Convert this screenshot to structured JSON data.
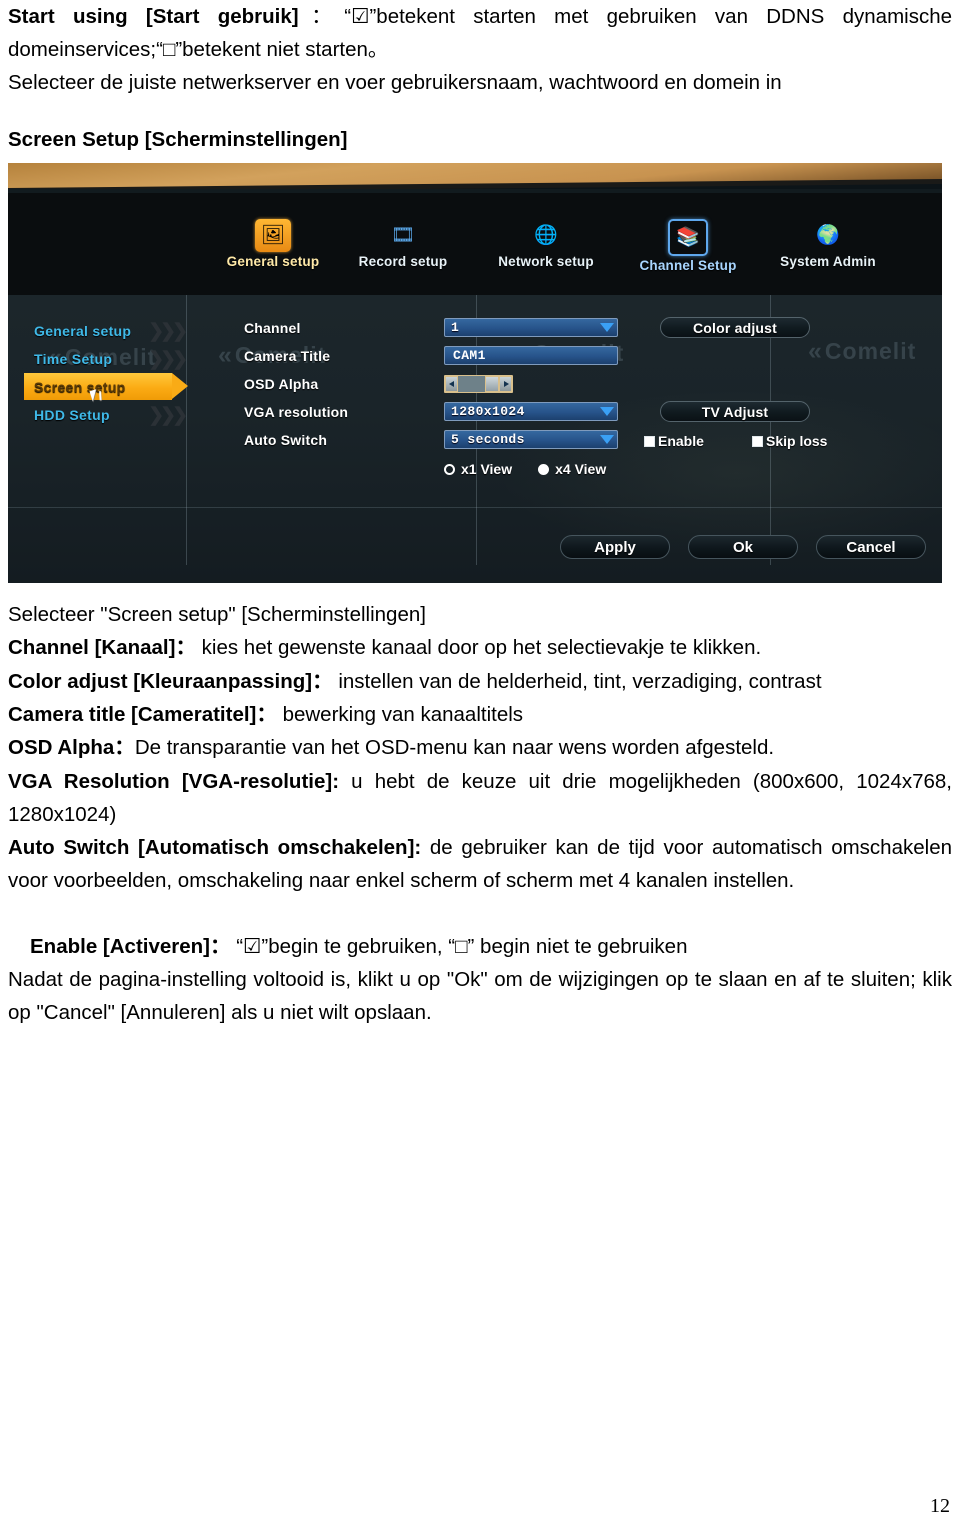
{
  "document": {
    "intro_paragraph_1": "Start using [Start gebruik]：“☑”betekent starten met gebruiken van DDNS dynamische domeinservices;“□”betekent niet starten。",
    "intro_p1_bold": "Start using [Start gebruik]",
    "intro_p1_rest": "：“☑”betekent starten met gebruiken van DDNS dynamische domeinservices;“□”betekent niet starten。",
    "intro_paragraph_2": "Selecteer de juiste netwerkserver en voer gebruikersnaam, wachtwoord en domein in",
    "section_heading": "Screen Setup [Scherminstellingen]",
    "line_select": "Selecteer \"Screen setup\" [Scherminstellingen]",
    "items": [
      {
        "term": "Channel [Kanaal]：",
        "desc": "kies het gewenste kanaal door op het selectievakje te klikken."
      },
      {
        "term": "Color adjust [Kleuraanpassing]：",
        "desc": "instellen van de helderheid, tint, verzadiging, contrast"
      },
      {
        "term": "Camera title [Cameratitel]：",
        "desc": "bewerking van kanaaltitels"
      },
      {
        "term": "OSD Alpha：",
        "desc": "De transparantie van het OSD-menu kan naar wens worden afgesteld."
      },
      {
        "term": "VGA Resolution [VGA-resolutie]:",
        "desc": "u hebt de keuze uit drie mogelijkheden (800x600, 1024x768, 1280x1024)"
      },
      {
        "term": "Auto Switch [Automatisch omschakelen]:",
        "desc": "de gebruiker kan de tijd voor automatisch omschakelen voor voorbeelden, omschakeling naar enkel scherm of scherm met 4 kanalen instellen."
      },
      {
        "term": "Enable [Activeren]：",
        "desc": "“☑”begin te gebruiken, “□” begin niet te gebruiken"
      }
    ],
    "closing_paragraph": "Nadat de pagina-instelling voltooid is, klikt u op \"Ok\" om de wijzigingen op te slaan en af te sluiten; klik op \"Cancel\" [Annuleren] als u niet wilt opslaan.",
    "page_number": "12"
  },
  "dvr": {
    "topnav": [
      {
        "label": "General setup",
        "icon": "general-setup-icon",
        "state": "highlighted-orange"
      },
      {
        "label": "Record setup",
        "icon": "record-setup-icon",
        "state": "normal"
      },
      {
        "label": "Network setup",
        "icon": "network-setup-icon",
        "state": "normal"
      },
      {
        "label": "Channel Setup",
        "icon": "channel-setup-icon",
        "state": "highlighted-blue"
      },
      {
        "label": "System Admin",
        "icon": "system-admin-icon",
        "state": "normal"
      }
    ],
    "sidebar": [
      {
        "label": "General setup",
        "active": false
      },
      {
        "label": "Time Setup",
        "active": false
      },
      {
        "label": "Screen setup",
        "active": true
      },
      {
        "label": "HDD Setup",
        "active": false
      }
    ],
    "form": {
      "channel_label": "Channel",
      "channel_value": "1",
      "camera_title_label": "Camera Title",
      "camera_title_value": "CAM1",
      "osd_alpha_label": "OSD Alpha",
      "vga_resolution_label": "VGA resolution",
      "vga_resolution_value": "1280x1024",
      "auto_switch_label": "Auto Switch",
      "auto_switch_value": "5 seconds",
      "view_x1_label": "x1 View",
      "view_x4_label": "x4 View",
      "color_adjust_label": "Color adjust",
      "tv_adjust_label": "TV Adjust",
      "enable_label": "Enable",
      "skip_loss_label": "Skip loss"
    },
    "actions": {
      "apply": "Apply",
      "ok": "Ok",
      "cancel": "Cancel"
    },
    "watermark": "Comelit",
    "colors": {
      "accent_orange": "#fbab14",
      "accent_blue": "#5fa8ee",
      "sidebar_text": "#3fb9e8",
      "field_blue": "#27538a"
    }
  }
}
